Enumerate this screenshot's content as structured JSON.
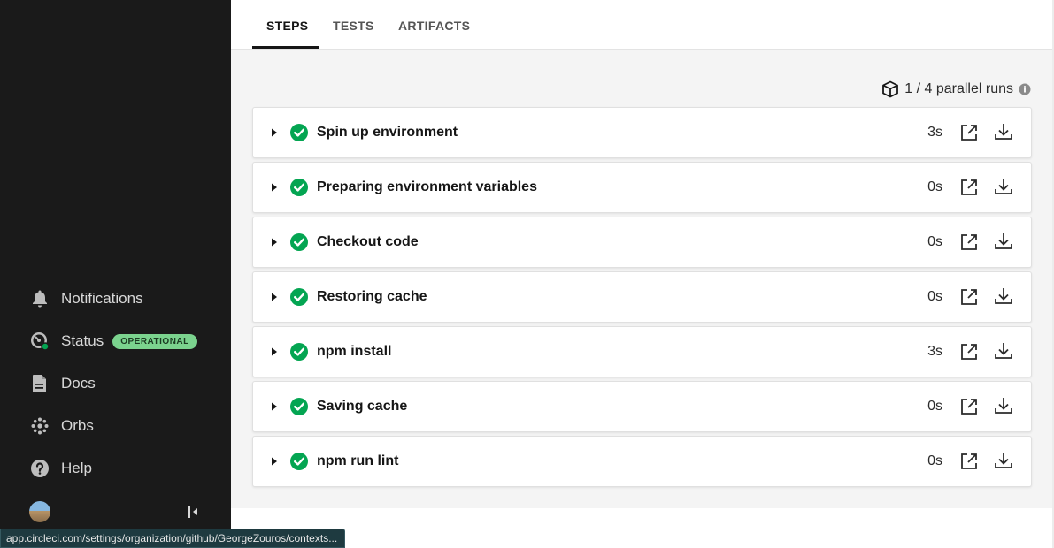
{
  "sidebar": {
    "items": [
      {
        "label": "Notifications",
        "icon": "bell-icon"
      },
      {
        "label": "Status",
        "icon": "status-gauge-icon",
        "badge": "OPERATIONAL"
      },
      {
        "label": "Docs",
        "icon": "document-icon"
      },
      {
        "label": "Orbs",
        "icon": "orbs-icon"
      },
      {
        "label": "Help",
        "icon": "help-icon"
      }
    ]
  },
  "tabs": [
    {
      "label": "STEPS",
      "active": true
    },
    {
      "label": "TESTS",
      "active": false
    },
    {
      "label": "ARTIFACTS",
      "active": false
    }
  ],
  "parallel": {
    "text": "1 / 4 parallel runs"
  },
  "steps": [
    {
      "name": "Spin up environment",
      "duration": "3s",
      "status": "success"
    },
    {
      "name": "Preparing environment variables",
      "duration": "0s",
      "status": "success"
    },
    {
      "name": "Checkout code",
      "duration": "0s",
      "status": "success"
    },
    {
      "name": "Restoring cache",
      "duration": "0s",
      "status": "success"
    },
    {
      "name": "npm install",
      "duration": "3s",
      "status": "success"
    },
    {
      "name": "Saving cache",
      "duration": "0s",
      "status": "success"
    },
    {
      "name": "npm run lint",
      "duration": "0s",
      "status": "success"
    }
  ],
  "statusbar": {
    "url": "app.circleci.com/settings/organization/github/GeorgeZouros/contexts..."
  },
  "colors": {
    "sidebar_bg": "#1a1a1a",
    "success": "#04a552",
    "badge_bg": "#7bd38e",
    "content_bg": "#f4f4f4"
  }
}
